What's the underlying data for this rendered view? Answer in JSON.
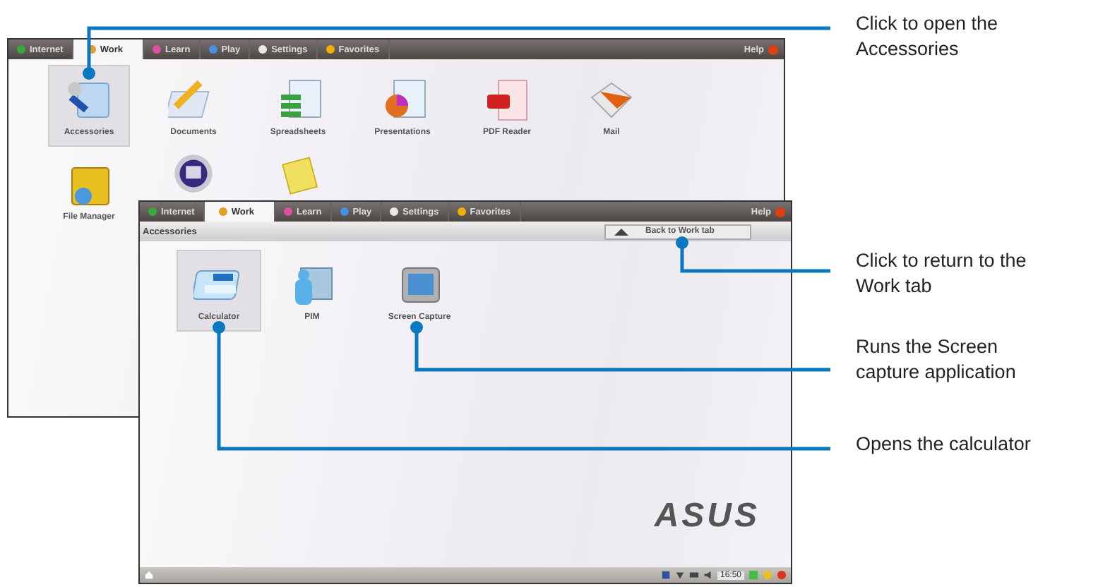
{
  "back_window": {
    "tabs": [
      {
        "label": "Internet",
        "selected": false,
        "color": "#3aa83a"
      },
      {
        "label": "Work",
        "selected": true,
        "color": "#e0a020"
      },
      {
        "label": "Learn",
        "selected": false,
        "color": "#e050a0"
      },
      {
        "label": "Play",
        "selected": false,
        "color": "#4a90e0"
      },
      {
        "label": "Settings",
        "selected": false,
        "color": "#e8e8e8"
      },
      {
        "label": "Favorites",
        "selected": false,
        "color": "#f0b000"
      }
    ],
    "help": "Help",
    "items": [
      {
        "label": "Accessories",
        "kind": "accessories",
        "selected": true
      },
      {
        "label": "Documents",
        "kind": "documents",
        "selected": false
      },
      {
        "label": "Spreadsheets",
        "kind": "spreadsheets",
        "selected": false
      },
      {
        "label": "Presentations",
        "kind": "presentations",
        "selected": false
      },
      {
        "label": "PDF Reader",
        "kind": "pdf",
        "selected": false
      },
      {
        "label": "Mail",
        "kind": "mail",
        "selected": false
      },
      {
        "label": "File Manager",
        "kind": "folder",
        "selected": false
      },
      {
        "kind": "ship",
        "selected": false
      },
      {
        "kind": "note",
        "selected": false
      }
    ]
  },
  "front_window": {
    "tabs": [
      {
        "label": "Internet",
        "selected": false,
        "color": "#3aa83a"
      },
      {
        "label": "Work",
        "selected": true,
        "color": "#e0a020"
      },
      {
        "label": "Learn",
        "selected": false,
        "color": "#e050a0"
      },
      {
        "label": "Play",
        "selected": false,
        "color": "#4a90e0"
      },
      {
        "label": "Settings",
        "selected": false,
        "color": "#e8e8e8"
      },
      {
        "label": "Favorites",
        "selected": false,
        "color": "#f0b000"
      }
    ],
    "help": "Help",
    "breadcrumb": "Accessories",
    "back_button": "Back to Work tab",
    "items": [
      {
        "label": "Calculator",
        "kind": "calculator",
        "selected": true
      },
      {
        "label": "PIM",
        "kind": "pim",
        "selected": false
      },
      {
        "label": "Screen Capture",
        "kind": "screen",
        "selected": false
      }
    ],
    "logo": "ASUS",
    "taskbar": {
      "time": "16:50"
    }
  },
  "callouts": [
    {
      "text": "Click to open the Accessories"
    },
    {
      "text": "Click to return to the Work tab"
    },
    {
      "text": "Runs the Screen capture application"
    },
    {
      "text": "Opens the calculator"
    }
  ]
}
